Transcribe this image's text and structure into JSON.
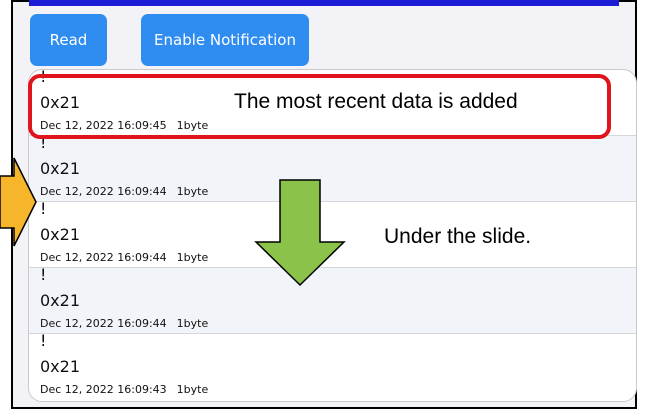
{
  "toolbar": {
    "read_label": "Read",
    "notify_label": "Enable Notification"
  },
  "list": {
    "rows": [
      {
        "mark": "!",
        "value": "0x21",
        "timestamp": "Dec 12, 2022 16:09:45",
        "size": "1byte"
      },
      {
        "mark": "!",
        "value": "0x21",
        "timestamp": "Dec 12, 2022 16:09:44",
        "size": "1byte"
      },
      {
        "mark": "!",
        "value": "0x21",
        "timestamp": "Dec 12, 2022 16:09:44",
        "size": "1byte"
      },
      {
        "mark": "!",
        "value": "0x21",
        "timestamp": "Dec 12, 2022 16:09:44",
        "size": "1byte"
      },
      {
        "mark": "!",
        "value": "0x21",
        "timestamp": "Dec 12, 2022 16:09:43",
        "size": "1byte"
      }
    ]
  },
  "annotations": {
    "recent": "The most recent data is added",
    "slide": "Under the slide."
  },
  "colors": {
    "button": "#2f8cf0",
    "highlight": "#e0141c",
    "down_arrow": "#8bc34a",
    "side_arrow": "#f7b52c",
    "top_bar": "#1c1cd6"
  },
  "icons": {
    "down_arrow": "arrow-down-icon",
    "side_arrow": "arrow-right-icon"
  }
}
